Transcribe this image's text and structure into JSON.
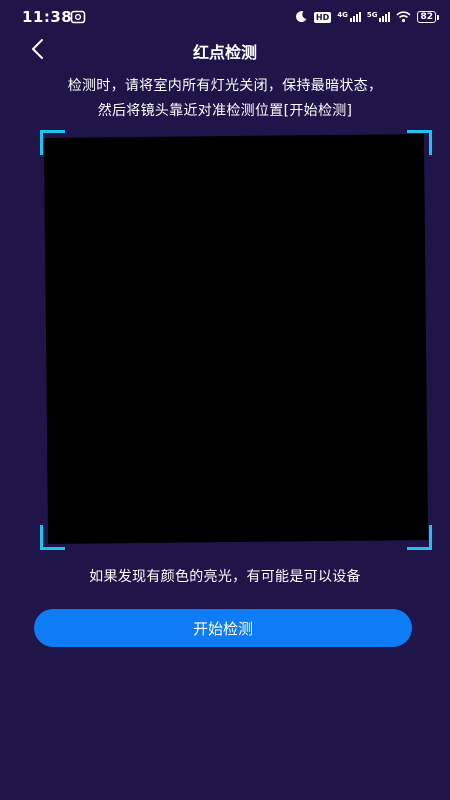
{
  "status_bar": {
    "time": "11:38",
    "hd_label": "HD",
    "network_1": "4G",
    "network_2": "5G",
    "battery": "82"
  },
  "nav": {
    "title": "红点检测",
    "back_icon": "chevron-left-icon"
  },
  "instructions": {
    "line1": "检测时，请将室内所有灯光关闭，保持最暗状态，",
    "line2": "然后将镜头靠近对准检测位置[开始检测]"
  },
  "hint": "如果发现有颜色的亮光，有可能是可以设备",
  "start_button": "开始检测",
  "colors": {
    "background": "#1f1548",
    "accent_corner": "#1ec3f0",
    "button": "#0e7cf5",
    "camera": "#000000"
  }
}
